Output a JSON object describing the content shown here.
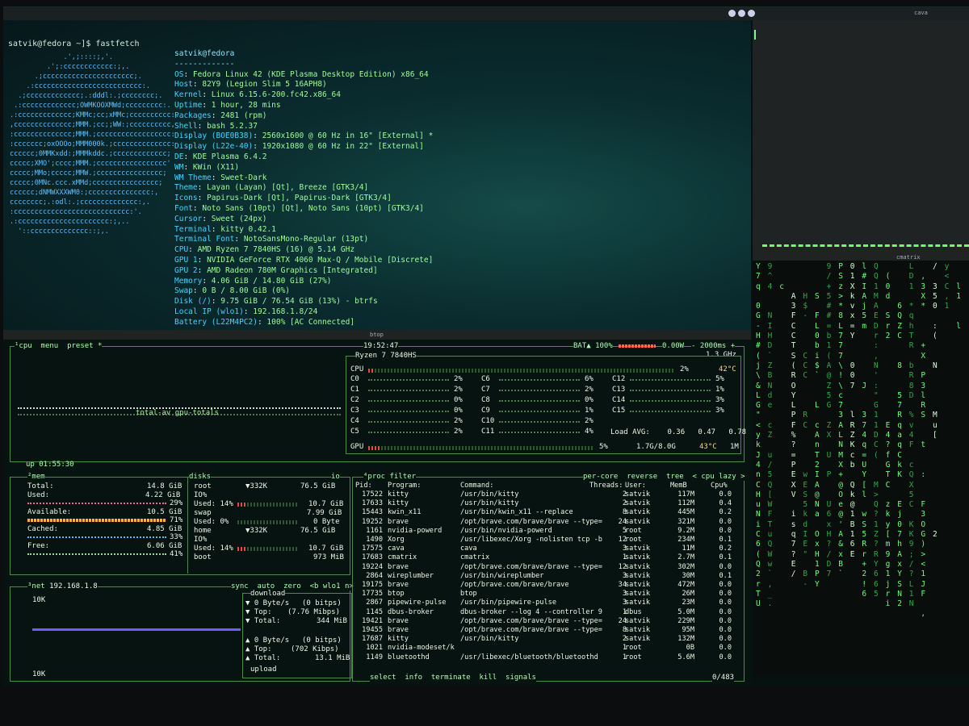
{
  "topbar": {
    "cava_title": "cava"
  },
  "fastfetch": {
    "prompt": "satvik@fedora ~]$ fastfetch",
    "logo_lines": [
      "             .',;::::;,'.",
      "         .';:cccccccccccc:;,.",
      "      .;cccccccccccccccccccccc;.",
      "    .:cccccccccccccccccccccccccc:.",
      "  .;ccccccccccccc;.:dddl:.;cccccccc;.",
      " .:ccccccccccccc;OWMKOOXMWd;ccccccccc:.",
      ".:ccccccccccccc;KMMc;cc;xMMc;cccccccccc:.",
      ",cccccccccccccc;MMM.;cc;;WW:;cccccccccc,",
      ":cccccccccccccc;MMM.;cccccccccccccccccc:",
      ":ccccccc;oxOOOo;MMM000k.;cccccccccccccc:",
      "cccccc;0MMKxdd:;MMMkddc.;ccccccccccccc;",
      "ccccc;XMO';cccc;MMM.;ccccccccccccccccc'",
      "ccccc;MMo;ccccc;MMW.;cccccccccccccccc;",
      "ccccc;0MNc.ccc.xMMd;cccccccccccccccc;",
      "cccccc;dNMWXXXWM0:;ccccccccccccccc:,",
      "cccccccc;.:odl:.;cccccccccccccc:,.",
      ":cccccccccccccccccccccccccccc:'.",
      ".:cccccccccccccccccccccc:;,..",
      "  '::cccccccccccccc::;,."
    ],
    "header": "satvik@fedora",
    "separator": "-------------",
    "rows": [
      {
        "key": "OS",
        "value": "Fedora Linux 42 (KDE Plasma Desktop Edition) x86_64"
      },
      {
        "key": "Host",
        "value": "82Y9 (Legion Slim 5 16APH8)"
      },
      {
        "key": "Kernel",
        "value": "Linux 6.15.6-200.fc42.x86_64"
      },
      {
        "key": "Uptime",
        "value": "1 hour, 28 mins"
      },
      {
        "key": "Packages",
        "value": "2481 (rpm)"
      },
      {
        "key": "Shell",
        "value": "bash 5.2.37"
      },
      {
        "key": "Display (BOE0B38)",
        "value": "2560x1600 @ 60 Hz in 16\" [External] *"
      },
      {
        "key": "Display (L22e-40)",
        "value": "1920x1080 @ 60 Hz in 22\" [External]"
      },
      {
        "key": "DE",
        "value": "KDE Plasma 6.4.2"
      },
      {
        "key": "WM",
        "value": "KWin (X11)"
      },
      {
        "key": "WM Theme",
        "value": "Sweet-Dark"
      },
      {
        "key": "Theme",
        "value": "Layan (Layan) [Qt], Breeze [GTK3/4]"
      },
      {
        "key": "Icons",
        "value": "Papirus-Dark [Qt], Papirus-Dark [GTK3/4]"
      },
      {
        "key": "Font",
        "value": "Noto Sans (10pt) [Qt], Noto Sans (10pt) [GTK3/4]"
      },
      {
        "key": "Cursor",
        "value": "Sweet (24px)"
      },
      {
        "key": "Terminal",
        "value": "kitty 0.42.1"
      },
      {
        "key": "Terminal Font",
        "value": "NotoSansMono-Regular (13pt)"
      },
      {
        "key": "CPU",
        "value": "AMD Ryzen 7 7840HS (16) @ 5.14 GHz"
      },
      {
        "key": "GPU 1",
        "value": "NVIDIA GeForce RTX 4060 Max-Q / Mobile [Discrete]"
      },
      {
        "key": "GPU 2",
        "value": "AMD Radeon 780M Graphics [Integrated]"
      },
      {
        "key": "Memory",
        "value": "4.06 GiB / 14.80 GiB (27%)"
      },
      {
        "key": "Swap",
        "value": "0 B / 8.00 GiB (0%)"
      },
      {
        "key": "Disk (/)",
        "value": "9.75 GiB / 76.54 GiB (13%) - btrfs"
      },
      {
        "key": "Local IP (wlo1)",
        "value": "192.168.1.8/24"
      },
      {
        "key": "Battery (L22M4PC2)",
        "value": "100% [AC Connected]"
      }
    ]
  },
  "cmatrix": {
    "title": "cmatrix",
    "columns": [
      "Y\n7\nq\n\n0\nG\n-\nH\n#\n(\nj\n\\\n&\nL\nG\n\"\n<\ny\nk\nJ\n4\nn\nC\nH\nu\nN\ni\nC\n6\n(\nQ\n2\nr\nT\nU",
      "9\n^\n4\n\n\nN\nI\nH\nD\n`\nZ\nB\nN\nd\ne\n\nc\nZ\n\nu\n/\n5\nQ\n[\nW\nF\nT\nu\nQ\nW\nw\n`\n,\n_\n.",
      "\n\nc\n\n",
      "\n\n\nA\n3\nF\nC\nC\nT\nS\n(\nR\nO\nY\nL\nP\nF\n%\n?\n=\nP\nE\nX\nV\n\ni\ns\nq\n7\n?\nE\n/",
      "\n\n\nH\n$\n-\n\n\n\nC\nC\nC\n\n\n\nR\nC\n\n\n\n\nw\nE\nS\n5\nk\nd\nI\nE\n\"\n\nB\n-",
      "\n\n\nS\n\nF\nL\n0\nb\ni\n$\n`\n\n\nL\n\nc\nA\nn\nT\n2\nI\nA\n@\nN\na\n\nO\nx\nH\n1\nP\nY",
      "9\n/\n+\n5\n#\n#\n=\nb\n1\n(\nA\n@\nZ\n5\nG\n\nZ\nX\n\nU\n\nP\n\n\nU\n6\nx\nH\n?\n/\nD\n7",
      "P\nS\nz\n>\n*\n8\nL\n7\n7\n7\n\\\n!\n\\\nc\n7\n3\nA\nL\nN\nM\nX\n+\n@\nO\ne\n@\n'\nA\n&\nx\nB\n`",
      "0\n1\nX\nk\nv\nx\n=\nY\n\n\n0\n0\n7\n\n\nl\nR\nZ\nK\nc\nb\n\nQ\nk\n@\n1\nB\n1\n6\nE",
      "l\n#\nI\nA\nj\n5\nm\n\n\n\n\n\nJ\n\n\n3\n7\n4\nq\n=\nU\nY\n[\nl\n\nw\nS\n5\nR\nr\n+\n2\n!\n6",
      "Q\nQ\n1\nM\nA\nE\nD\nr\n:\n,\nN\n'\n:\n\"\nG\n1\n1\nD\nC\n(\n\n\nM\n>\nQ\n?\n1\nZ\n?\nR\nY\n6\n6\n5",
      "\n(\n0\nd\n\nS\nr\n2\n\n \n\n \n\n \n\n \nE\n4\n?\nf\nG\nT\nC\n\nz\nk\ny\n[\nm\n9\ng\n1\nj\nr\ni",
      "\n\n\n\n6\nQ\nZ\nC\n\n\n8\n \n\n5\n7\nR\nq\na\nq\nC\nk\nK\n\n\nE\nj\n0\n7\nh\nA\nx\nY\nS\nN\n2",
      "L\nD\n1\n\n*\nq\nh\nT\nR\n\nb\nR\n8\nD\n\n%\nv\n4\nF\n\nc\nQ\nX\n5\nC\n\nK\nK\n9\n;\n/\n?\nL\n1\nN",
      "\n,\n3\nX\n*\n\n\n\n+\nX\n\nP\n3\nl\nR\nS\n\n\nt\n \n\n:\n\n\nF\n3\nO\nG\n)\n>\n<\n1\nJ\nF\n\n,",
      "/\n\n3\n5\n0\n\n:\n(\n\n\nN\n\n\n\n\nM\nu\n[\n\n \n\n\n\n \n \n \n\n2\n\n\n\n\n\n\n",
      "y\n<\nC\n,\n1\n\n\n\n\n\n\n\n\n\n\n\n\n\n\n\n\n\n\n\n\n\n\n\n\n\n\n\n\n\n",
      "\n\nl\n1\n\n\nl\n\n\n\n\n\n\n\n\n\n\n\n\n\n\n\n\n\n"
    ]
  },
  "btop": {
    "title": "btop",
    "cpu_header": {
      "label": "¹cpu",
      "menu": "menu",
      "preset": "preset *"
    },
    "time": "19:52:47",
    "battery": "BAT▲ 100%",
    "power": "0.00W",
    "interval": "- 2000ms +",
    "cpu_name": "Ryzen 7 7840HS",
    "cpu_freq": "1.3 GHz",
    "graph_label": "total-av gpu-totals",
    "uptime": "up 01:55:30",
    "cpu_total": {
      "label": "CPU",
      "pct": "2%",
      "temp": "42°C",
      "fill": 0.02
    },
    "cores": [
      {
        "name": "C0",
        "pct": "2%",
        "fill": 0.02
      },
      {
        "name": "C1",
        "pct": "2%",
        "fill": 0.02
      },
      {
        "name": "C2",
        "pct": "0%",
        "fill": 0.0
      },
      {
        "name": "C3",
        "pct": "0%",
        "fill": 0.0
      },
      {
        "name": "C4",
        "pct": "2%",
        "fill": 0.02
      },
      {
        "name": "C5",
        "pct": "2%",
        "fill": 0.02
      },
      {
        "name": "C6",
        "pct": "6%",
        "fill": 0.06
      },
      {
        "name": "C7",
        "pct": "2%",
        "fill": 0.02
      },
      {
        "name": "C8",
        "pct": "0%",
        "fill": 0.0
      },
      {
        "name": "C9",
        "pct": "1%",
        "fill": 0.01
      },
      {
        "name": "C10",
        "pct": "2%",
        "fill": 0.02
      },
      {
        "name": "C11",
        "pct": "4%",
        "fill": 0.04
      },
      {
        "name": "C12",
        "pct": "5%",
        "fill": 0.05
      },
      {
        "name": "C13",
        "pct": "1%",
        "fill": 0.01
      },
      {
        "name": "C14",
        "pct": "3%",
        "fill": 0.03
      },
      {
        "name": "C15",
        "pct": "3%",
        "fill": 0.03
      }
    ],
    "core_c11_extra": "4%",
    "load_avg": {
      "label": "Load AVG:",
      "values": [
        "0.36",
        "0.47",
        "0.78"
      ]
    },
    "gpu": {
      "label": "GPU",
      "pct": "5%",
      "mem": "1.7G/8.0G",
      "temp": "43°C",
      "mode": "1M",
      "fill": 0.05
    },
    "mem": {
      "label": "²mem",
      "total_label": "Total:",
      "total": "14.8 GiB",
      "used_label": "Used:",
      "used": "4.22 GiB",
      "used_pct": "29%",
      "avail_label": "Available:",
      "avail": "10.5 GiB",
      "avail_pct": "71%",
      "cached_label": "Cached:",
      "cached": "4.85 GiB",
      "cached_pct": "33%",
      "free_label": "Free:",
      "free": "6.06 GiB",
      "free_pct": "41%"
    },
    "disks": {
      "label": "disks",
      "io": "io",
      "root": {
        "name": "root",
        "speed": "▼332K",
        "size": "76.5 GiB",
        "io": "IO%",
        "used_label": "Used:",
        "used_pct": "14%",
        "used": "10.7 GiB"
      },
      "swap": {
        "name": "swap",
        "size": "7.99 GiB",
        "used_label": "Used:",
        "used_pct": "0%",
        "used": "0 Byte"
      },
      "home": {
        "name": "home",
        "speed": "▼332K",
        "size": "76.5 GiB",
        "io": "IO%",
        "used_label": "Used:",
        "used_pct": "14%",
        "used": "10.7 GiB"
      },
      "boot": {
        "name": "boot",
        "size": "973 MiB"
      }
    },
    "net": {
      "label": "³net",
      "ip": "192.168.1.8",
      "controls": [
        "sync",
        "auto",
        "zero",
        "<b wlo1 n>"
      ],
      "scale_top": "10K",
      "scale_bottom": "10K",
      "download": {
        "label": "download",
        "rate": "0 Byte/s",
        "rate_bits": "(0 bitps)",
        "top_label": "Top:",
        "top": "(7.76 Mibps)",
        "total_label": "Total:",
        "total": "344 MiB"
      },
      "upload": {
        "label": "upload",
        "rate": "0 Byte/s",
        "rate_bits": "(0 bitps)",
        "top_label": "Top:",
        "top": "(702 Kibps)",
        "total_label": "Total:",
        "total": "13.1 MiB"
      }
    },
    "proc": {
      "label": "⁴proc",
      "filter": "filter",
      "opts": [
        "per-core",
        "reverse",
        "tree",
        "< cpu lazy >"
      ],
      "headers": {
        "pid": "Pid:",
        "program": "Program:",
        "command": "Command:",
        "threads": "Threads:",
        "user": "User:",
        "mem": "MemB",
        "cpu": "Cpu%"
      },
      "rows": [
        {
          "pid": "17522",
          "program": "kitty",
          "command": "/usr/bin/kitty",
          "threads": "2",
          "user": "satvik",
          "mem": "117M",
          "cpu": "0.0"
        },
        {
          "pid": "17633",
          "program": "kitty",
          "command": "/usr/bin/kitty",
          "threads": "2",
          "user": "satvik",
          "mem": "112M",
          "cpu": "0.4"
        },
        {
          "pid": "15443",
          "program": "kwin_x11",
          "command": "/usr/bin/kwin_x11 --replace",
          "threads": "8",
          "user": "satvik",
          "mem": "445M",
          "cpu": "0.2"
        },
        {
          "pid": "19252",
          "program": "brave",
          "command": "/opt/brave.com/brave/brave --type=",
          "threads": "24",
          "user": "satvik",
          "mem": "321M",
          "cpu": "0.0"
        },
        {
          "pid": "1161",
          "program": "nvidia-powerd",
          "command": "/usr/bin/nvidia-powerd",
          "threads": "5",
          "user": "root",
          "mem": "9.2M",
          "cpu": "0.0"
        },
        {
          "pid": "1490",
          "program": "Xorg",
          "command": "/usr/libexec/Xorg -nolisten tcp -b",
          "threads": "12",
          "user": "root",
          "mem": "234M",
          "cpu": "0.1"
        },
        {
          "pid": "17575",
          "program": "cava",
          "command": "cava",
          "threads": "3",
          "user": "satvik",
          "mem": "11M",
          "cpu": "0.2"
        },
        {
          "pid": "17683",
          "program": "cmatrix",
          "command": "cmatrix",
          "threads": "1",
          "user": "satvik",
          "mem": "2.7M",
          "cpu": "0.1"
        },
        {
          "pid": "19224",
          "program": "brave",
          "command": "/opt/brave.com/brave/brave --type=",
          "threads": "12",
          "user": "satvik",
          "mem": "302M",
          "cpu": "0.0"
        },
        {
          "pid": "2864",
          "program": "wireplumber",
          "command": "/usr/bin/wireplumber",
          "threads": "3",
          "user": "satvik",
          "mem": "30M",
          "cpu": "0.1"
        },
        {
          "pid": "19175",
          "program": "brave",
          "command": "/opt/brave.com/brave/brave",
          "threads": "34",
          "user": "satvik",
          "mem": "472M",
          "cpu": "0.0"
        },
        {
          "pid": "17735",
          "program": "btop",
          "command": "btop",
          "threads": "3",
          "user": "satvik",
          "mem": "26M",
          "cpu": "0.0"
        },
        {
          "pid": "2867",
          "program": "pipewire-pulse",
          "command": "/usr/bin/pipewire-pulse",
          "threads": "3",
          "user": "satvik",
          "mem": "23M",
          "cpu": "0.0"
        },
        {
          "pid": "1145",
          "program": "dbus-broker",
          "command": "dbus-broker --log 4 --controller 9",
          "threads": "1",
          "user": "dbus",
          "mem": "5.0M",
          "cpu": "0.0"
        },
        {
          "pid": "19421",
          "program": "brave",
          "command": "/opt/brave.com/brave/brave --type=",
          "threads": "24",
          "user": "satvik",
          "mem": "229M",
          "cpu": "0.0"
        },
        {
          "pid": "19455",
          "program": "brave",
          "command": "/opt/brave.com/brave/brave --type=",
          "threads": "8",
          "user": "satvik",
          "mem": "95M",
          "cpu": "0.0"
        },
        {
          "pid": "17687",
          "program": "kitty",
          "command": "/usr/bin/kitty",
          "threads": "2",
          "user": "satvik",
          "mem": "132M",
          "cpu": "0.0"
        },
        {
          "pid": "1021",
          "program": "nvidia-modeset/k",
          "command": "",
          "threads": "1",
          "user": "root",
          "mem": "0B",
          "cpu": "0.0"
        },
        {
          "pid": "1149",
          "program": "bluetoothd",
          "command": "/usr/libexec/bluetooth/bluetoothd",
          "threads": "1",
          "user": "root",
          "mem": "5.6M",
          "cpu": "0.0"
        }
      ],
      "footer": {
        "select": "select",
        "info": "info",
        "terminate": "terminate",
        "kill": "kill",
        "signals": "signals",
        "count": "0/483"
      }
    }
  }
}
